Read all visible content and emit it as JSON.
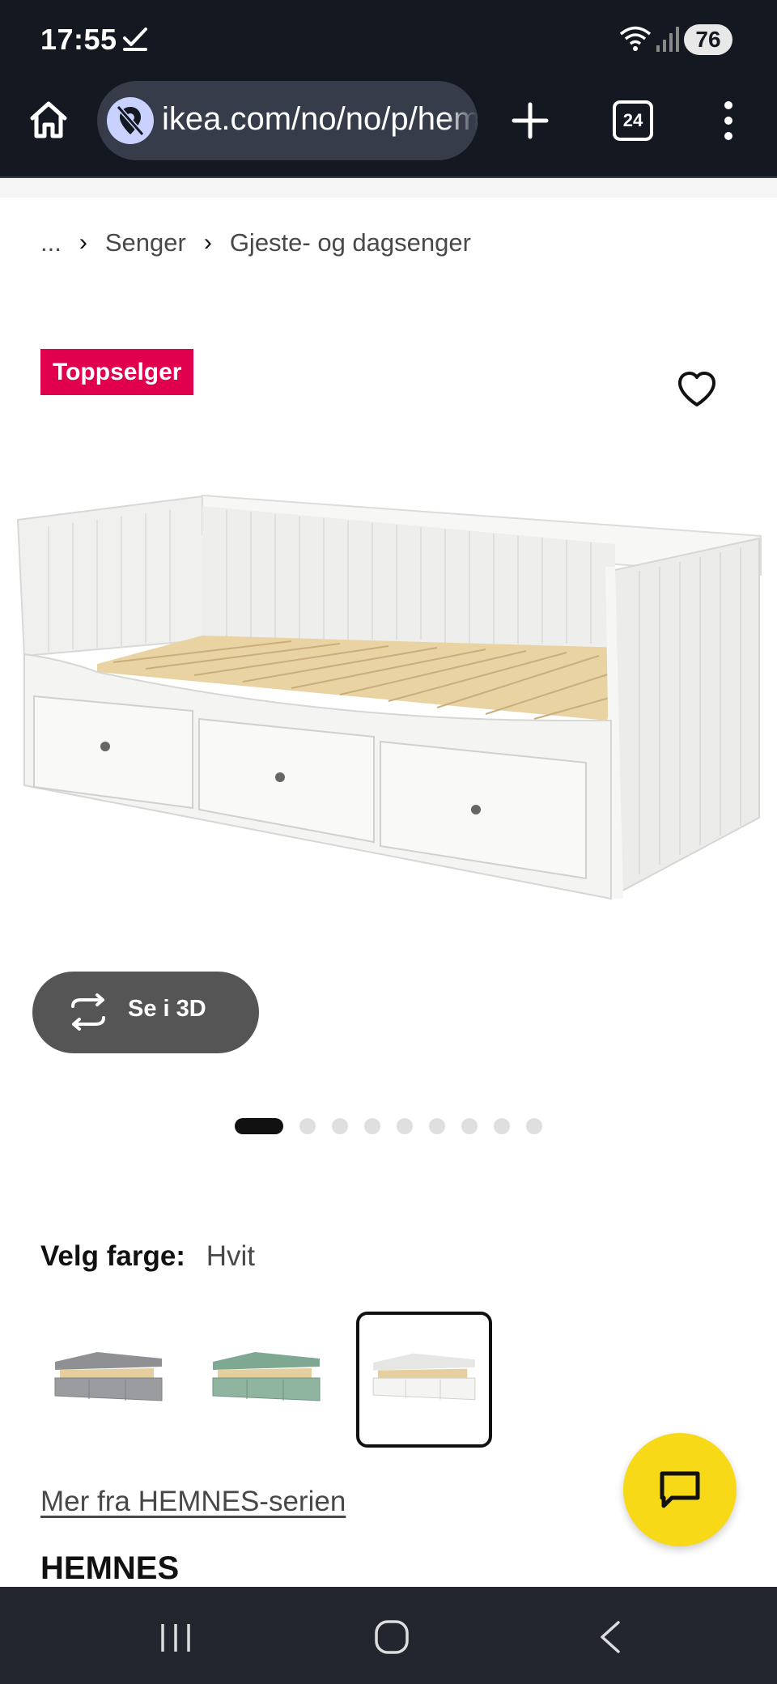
{
  "status_bar": {
    "time": "17:55",
    "battery": "76"
  },
  "browser": {
    "url": "ikea.com/no/no/p/hemnes",
    "tab_count": "24"
  },
  "breadcrumb": {
    "ellipsis": "...",
    "items": [
      "Senger",
      "Gjeste- og dagsenger"
    ]
  },
  "product": {
    "badge": "Toppselger",
    "view_3d_label": "Se i 3D",
    "carousel": {
      "total": 10,
      "active_index": 0
    },
    "color_label": "Velg farge:",
    "color_value": "Hvit",
    "swatches": [
      {
        "name": "gray",
        "color": "#9a9ca0",
        "selected": false
      },
      {
        "name": "green",
        "color": "#8fb5a0",
        "selected": false
      },
      {
        "name": "white",
        "color": "#f4f4f2",
        "selected": true
      }
    ],
    "series_link": "Mer fra HEMNES-serien",
    "name": "HEMNES"
  },
  "colors": {
    "badge_bg": "#e0004d",
    "chat_fab": "#f7d917",
    "status_bg": "#141820"
  },
  "icons": [
    "check-icon",
    "wifi-icon",
    "signal-icon",
    "home-icon",
    "location-off-icon",
    "plus-icon",
    "tabs-icon",
    "menu-icon",
    "heart-icon",
    "rotate-3d-icon",
    "chat-icon",
    "recents-icon",
    "home-nav-icon",
    "back-icon"
  ]
}
